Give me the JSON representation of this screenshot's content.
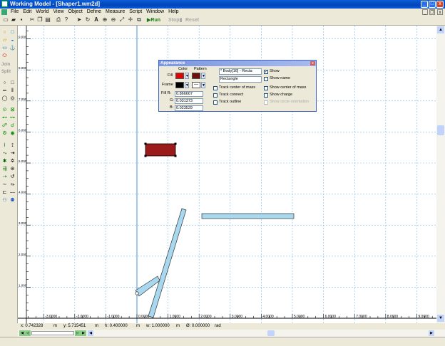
{
  "window": {
    "title": "Working Model - [Shaper1.wm2d]",
    "minimize": "_",
    "maximize": "□",
    "close": "x"
  },
  "menu": {
    "items": [
      "File",
      "Edit",
      "World",
      "View",
      "Object",
      "Define",
      "Measure",
      "Script",
      "Window",
      "Help"
    ],
    "mdi_min": "_",
    "mdi_restore": "❐",
    "mdi_close": "x"
  },
  "toolbar": {
    "run": "Run",
    "stop": "Stop",
    "reset": "Reset"
  },
  "palette": {
    "join": "Join",
    "split": "Split"
  },
  "status": {
    "x": "x: 0.742328",
    "x_unit": "m",
    "y": "y: 5.715451",
    "y_unit": "m",
    "h": "h: 0.400000",
    "h_unit": "m",
    "w": "w: 1.000000",
    "w_unit": "m",
    "angle": "Ø: 0.000000",
    "angle_unit": "rad"
  },
  "axes": {
    "x_ticks": [
      "-3.0000",
      "-2.0000",
      "-1.0000",
      "0.0000",
      "1.0000",
      "2.0000",
      "3.0000",
      "4.0000",
      "5.0000",
      "6.0000",
      "7.0000",
      "8.0000",
      "9.0000"
    ],
    "y_ticks": [
      "9.000",
      "8.000",
      "7.000",
      "6.000",
      "5.000",
      "4.000",
      "3.000",
      "2.000",
      "1.000"
    ]
  },
  "dialog": {
    "title": "Appearance",
    "col_color": "Color",
    "col_pattern": "Pattern",
    "fill_label": "Fill",
    "frame_label": "Frame",
    "r_label": "Fill  R:",
    "r_value": "0.866667",
    "g_label": "G:",
    "g_value": "0.031373",
    "b_label": "B:",
    "b_value": "0.023529",
    "body_select": "* Body[16] - Recta",
    "name_value": "Rectangle",
    "track_center": "Track center of mass",
    "track_connect": "Track connect",
    "track_outline": "Track outline",
    "show": "Show",
    "show_name": "Show name",
    "show_center": "Show center of mass",
    "show_charge": "Show charge",
    "show_circle": "Show circle orientation",
    "checked": "✓",
    "fill_color": "#dd0806",
    "pattern_color": "#6b0f0f",
    "frame_color": "#000000"
  },
  "colors": {
    "grid": "#7ab8e8",
    "body_blue": "#a8d8f0",
    "body_red": "#9b1a1a"
  }
}
